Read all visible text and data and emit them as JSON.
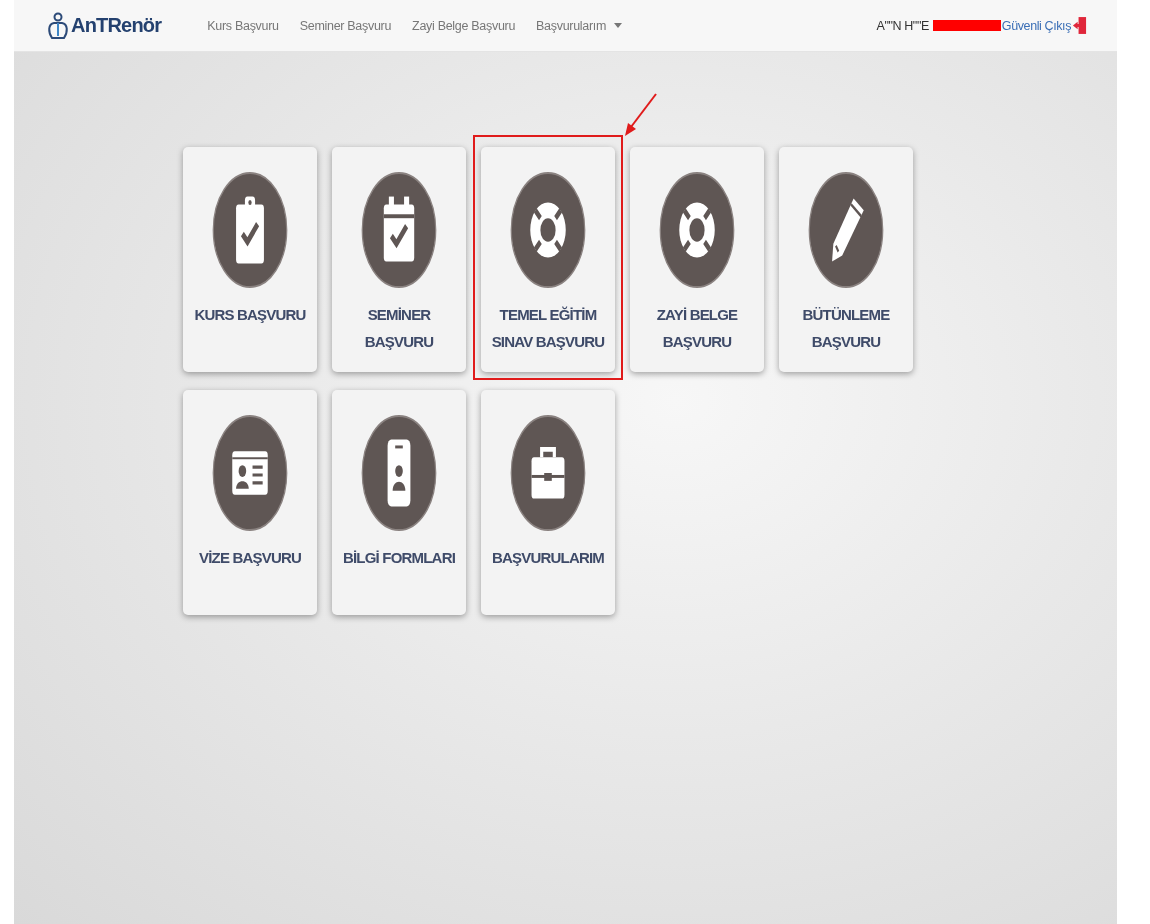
{
  "header": {
    "brand": "AnTRenör",
    "nav": [
      {
        "label": "Kurs Başvuru",
        "kind": "link"
      },
      {
        "label": "Seminer Başvuru",
        "kind": "link"
      },
      {
        "label": "Zayi Belge Başvuru",
        "kind": "link"
      },
      {
        "label": "Başvurularım",
        "kind": "dropdown"
      }
    ],
    "user": "A\"\"N H\"\"E",
    "redacted": true,
    "logout": "Güvenli Çıkış"
  },
  "tiles": [
    {
      "label": "KURS BAŞVURU",
      "kind": "clipboard",
      "highlighted": false
    },
    {
      "label": "SEMİNER BAŞVURU",
      "kind": "calendar",
      "highlighted": false
    },
    {
      "label": "TEMEL EĞİTİM SINAV BAŞVURU",
      "kind": "lifebuoy",
      "highlighted": true
    },
    {
      "label": "ZAYİ BELGE BAŞVURU",
      "kind": "lifebuoy",
      "highlighted": false
    },
    {
      "label": "BÜTÜNLEME BAŞVURU",
      "kind": "pencil",
      "highlighted": false
    },
    {
      "label": "VİZE BAŞVURU",
      "kind": "idcard",
      "highlighted": false
    },
    {
      "label": "BİLGİ FORMLARI",
      "kind": "phone",
      "highlighted": false
    },
    {
      "label": "BAŞVURULARIM",
      "kind": "briefcase",
      "highlighted": false
    }
  ]
}
